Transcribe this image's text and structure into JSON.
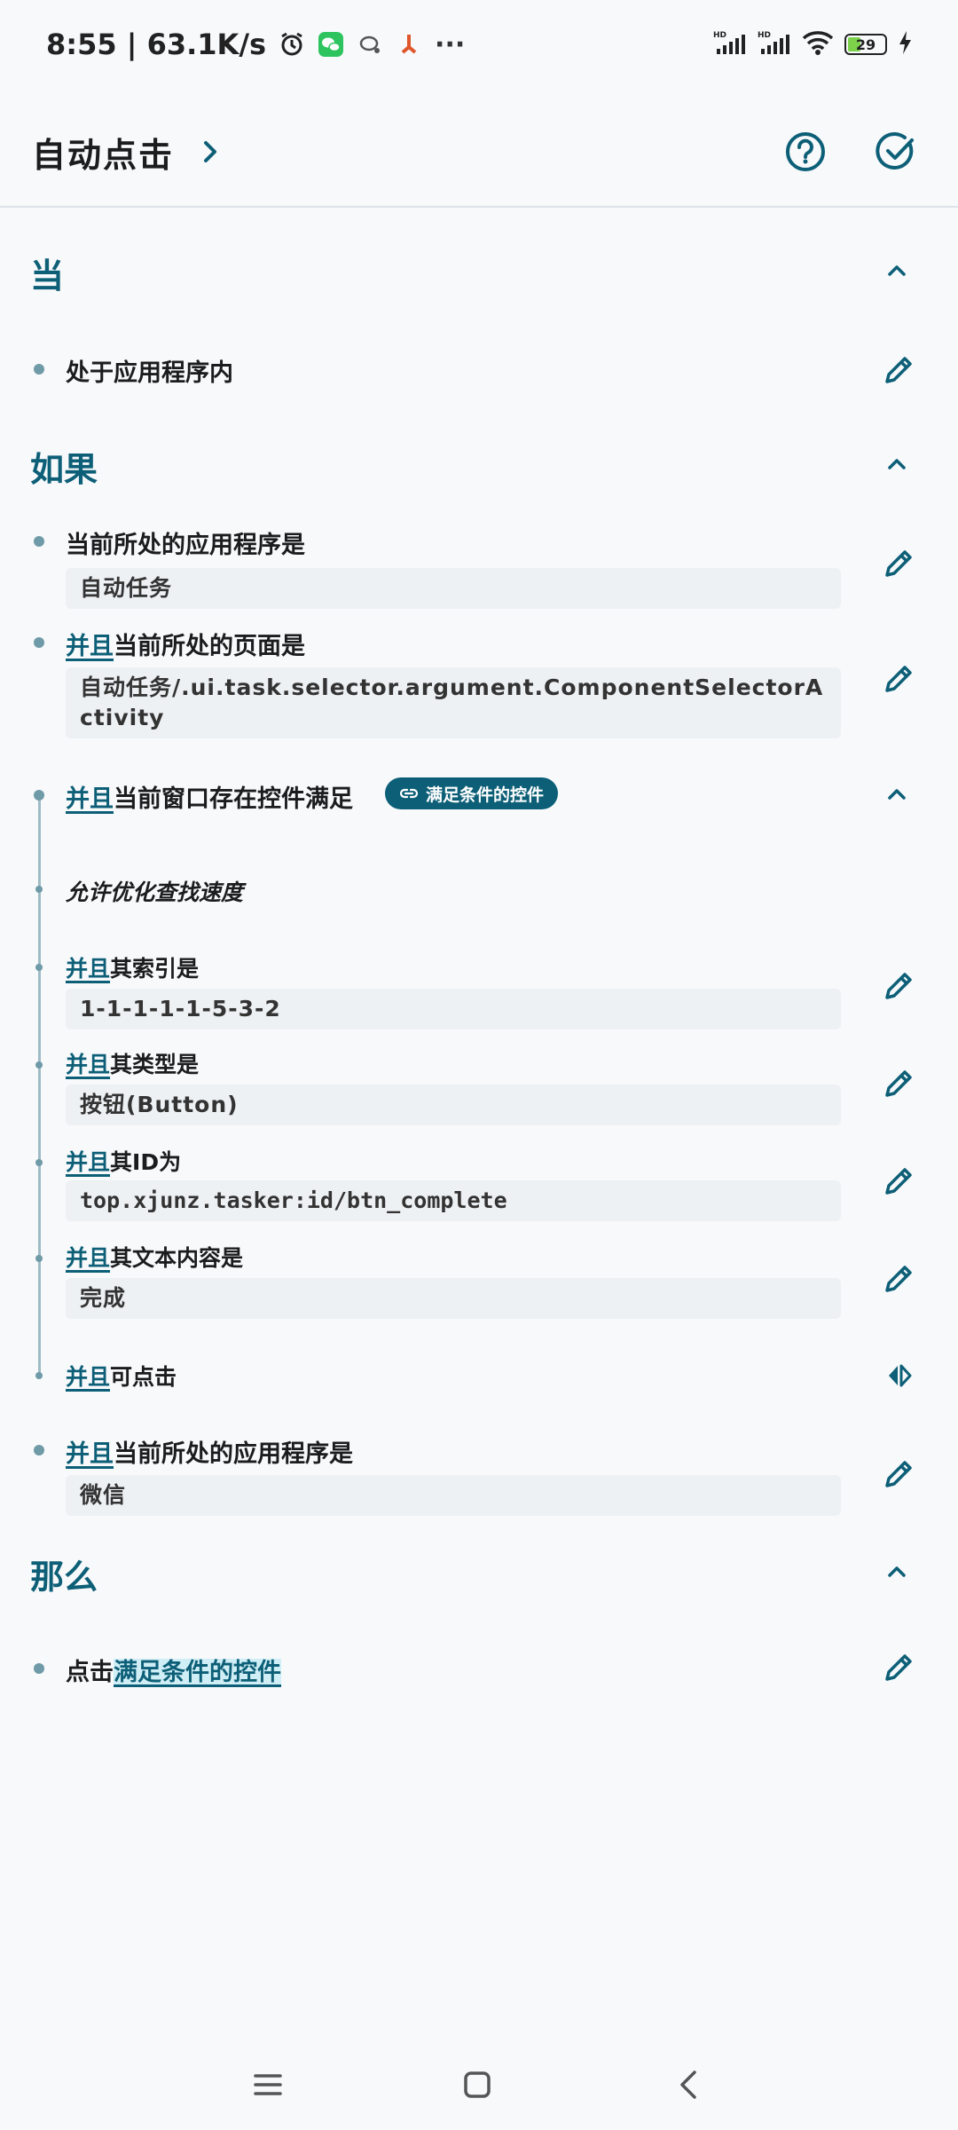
{
  "status_bar": {
    "time_speed": "8:55 | 63.1K/s",
    "battery": "29",
    "more": "···"
  },
  "app_bar": {
    "title": "自动点击"
  },
  "sections": {
    "when": {
      "title": "当"
    },
    "if": {
      "title": "如果"
    },
    "then": {
      "title": "那么"
    }
  },
  "when_items": {
    "in_app": "处于应用程序内"
  },
  "if_items": {
    "current_app": {
      "label": "当前所处的应用程序是",
      "value": "自动任务"
    },
    "current_page": {
      "and": "并且",
      "label": "当前所处的页面是",
      "value": "自动任务/.ui.task.selector.argument.ComponentSelectorActivity"
    },
    "window_widget": {
      "and": "并且",
      "label": "当前窗口存在控件满足",
      "chip": "满足条件的控件"
    },
    "optimize_note": "允许优化查找速度",
    "index": {
      "and": "并且",
      "label": "其索引是",
      "value": "1-1-1-1-1-5-3-2"
    },
    "type": {
      "and": "并且",
      "label": "其类型是",
      "value": "按钮(Button)"
    },
    "id": {
      "and": "并且",
      "label": "其ID为",
      "value": "top.xjunz.tasker:id/btn_complete"
    },
    "text": {
      "and": "并且",
      "label": "其文本内容是",
      "value": "完成"
    },
    "clickable": {
      "and": "并且",
      "label": "可点击"
    },
    "current_app2": {
      "and": "并且",
      "label": "当前所处的应用程序是",
      "value": "微信"
    }
  },
  "then_items": {
    "click": {
      "label": "点击",
      "link": "满足条件的控件"
    }
  },
  "colors": {
    "accent": "#0d5f77",
    "background": "#f7f9fb",
    "value_box": "#eef1f4"
  }
}
